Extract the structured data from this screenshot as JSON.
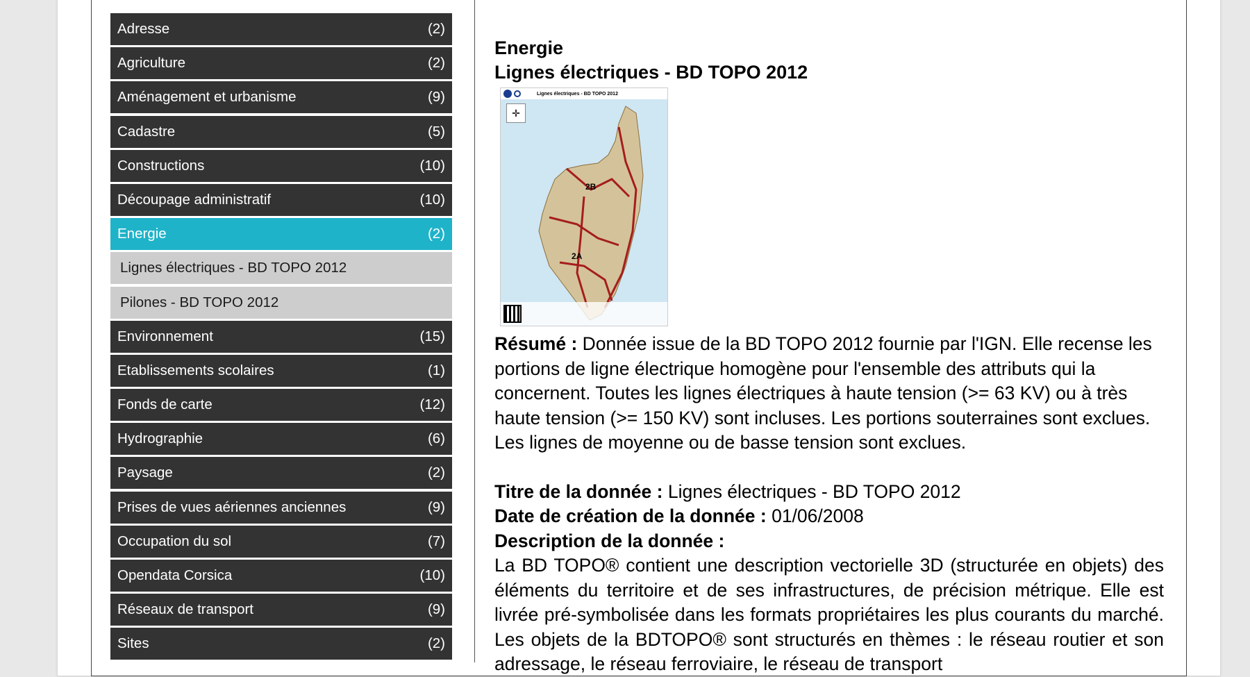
{
  "sidebar": {
    "categories": [
      {
        "label": "Adresse",
        "count": "(2)"
      },
      {
        "label": "Agriculture",
        "count": "(2)"
      },
      {
        "label": "Aménagement et urbanisme",
        "count": "(9)"
      },
      {
        "label": "Cadastre",
        "count": "(5)"
      },
      {
        "label": "Constructions",
        "count": "(10)"
      },
      {
        "label": "Découpage administratif",
        "count": "(10)"
      },
      {
        "label": "Energie",
        "count": "(2)"
      },
      {
        "label": "Environnement",
        "count": "(15)"
      },
      {
        "label": "Etablissements scolaires",
        "count": "(1)"
      },
      {
        "label": "Fonds de carte",
        "count": "(12)"
      },
      {
        "label": "Hydrographie",
        "count": "(6)"
      },
      {
        "label": "Paysage",
        "count": "(2)"
      },
      {
        "label": "Prises de vues aériennes anciennes",
        "count": "(9)"
      },
      {
        "label": "Occupation du sol",
        "count": "(7)"
      },
      {
        "label": "Opendata Corsica",
        "count": "(10)"
      },
      {
        "label": "Réseaux de transport",
        "count": "(9)"
      },
      {
        "label": "Sites",
        "count": "(2)"
      }
    ],
    "active_index": 6,
    "subitems": [
      {
        "label": "Lignes électriques - BD TOPO 2012"
      },
      {
        "label": "Pilones - BD TOPO 2012"
      }
    ],
    "active_color": "#1fb3c9",
    "item_color": "#333333",
    "subitem_color": "#cdcdcd"
  },
  "main": {
    "category_title": "Energie",
    "layer_title": "Lignes électriques - BD TOPO 2012",
    "thumbnail": {
      "header_text": "Lignes électriques - BD TOPO 2012",
      "labels": [
        "2B",
        "2A"
      ]
    },
    "resume_label": "Résumé :",
    "resume_text": "Donnée issue de la BD TOPO 2012 fournie par l'IGN. Elle recense les portions de ligne électrique homogène pour l'ensemble des attributs qui la concernent. Toutes les lignes électriques à haute tension (>= 63 KV) ou à très haute tension (>= 150 KV) sont incluses. Les portions souterraines sont exclues. Les lignes de moyenne ou de basse tension sont exclues.",
    "title_label": "Titre de la donnée :",
    "title_value": "Lignes électriques - BD TOPO 2012",
    "date_label": "Date de création de la donnée :",
    "date_value": "01/06/2008",
    "desc_label": "Description de la donnée :",
    "desc_text": "La BD TOPO® contient une description vectorielle 3D (structurée en objets) des éléments du territoire et de ses infrastructures, de précision métrique. Elle est livrée pré-symbolisée dans les formats propriétaires les plus courants du marché. Les objets de la BDTOPO® sont structurés en thèmes : le réseau routier et son adressage, le réseau ferroviaire, le réseau de transport"
  }
}
